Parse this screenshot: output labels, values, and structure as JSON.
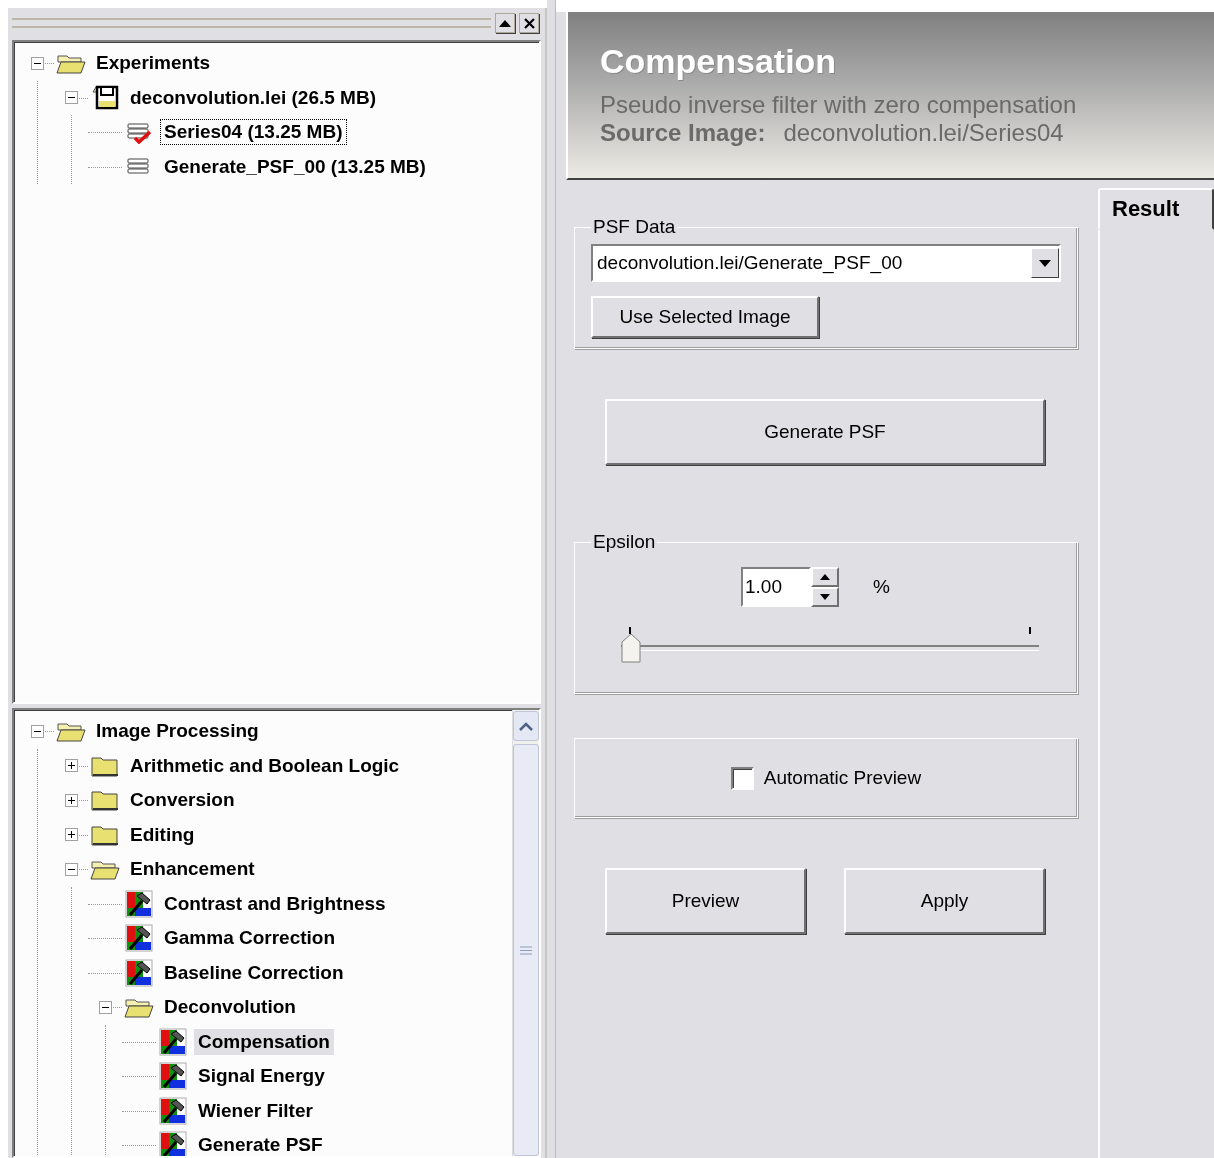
{
  "experiments_tree": {
    "focused": true,
    "items": [
      {
        "label": "Experiments",
        "kind": "folder",
        "expanded": true,
        "selected": false,
        "children": [
          {
            "label": "deconvolution.lei (26.5 MB)",
            "kind": "disk",
            "expanded": true,
            "selected": false,
            "children": [
              {
                "label": "Series04 (13.25 MB)",
                "kind": "series",
                "checked": true,
                "selected": true
              },
              {
                "label": "Generate_PSF_00 (13.25 MB)",
                "kind": "series",
                "checked": false,
                "selected": false
              }
            ]
          }
        ]
      }
    ]
  },
  "processing_tree": {
    "focused": false,
    "items": [
      {
        "label": "Image Processing",
        "kind": "folder",
        "expanded": true,
        "selected": false,
        "children": [
          {
            "label": "Arithmetic and Boolean Logic",
            "kind": "folder",
            "expanded": false,
            "selected": false
          },
          {
            "label": "Conversion",
            "kind": "folder",
            "expanded": false,
            "selected": false
          },
          {
            "label": "Editing",
            "kind": "folder",
            "expanded": false,
            "selected": false
          },
          {
            "label": "Enhancement",
            "kind": "folder",
            "expanded": true,
            "selected": false,
            "children": [
              {
                "label": "Contrast and Brightness",
                "kind": "tool",
                "selected": false
              },
              {
                "label": "Gamma Correction",
                "kind": "tool",
                "selected": false
              },
              {
                "label": "Baseline Correction",
                "kind": "tool",
                "selected": false
              },
              {
                "label": "Deconvolution",
                "kind": "folder",
                "expanded": true,
                "selected": false,
                "children": [
                  {
                    "label": "Compensation",
                    "kind": "tool",
                    "selected": true
                  },
                  {
                    "label": "Signal Energy",
                    "kind": "tool",
                    "selected": false
                  },
                  {
                    "label": "Wiener Filter",
                    "kind": "tool",
                    "selected": false
                  },
                  {
                    "label": "Generate PSF",
                    "kind": "tool",
                    "selected": false
                  }
                ]
              }
            ]
          }
        ]
      }
    ]
  },
  "header": {
    "title": "Compensation",
    "description": "Pseudo inverse filter with zero compensation",
    "source_label": "Source Image:",
    "source_value": "deconvolution.lei/Series04"
  },
  "tabs": [
    {
      "label": "Result",
      "selected": true
    }
  ],
  "psf_data": {
    "legend": "PSF Data",
    "dropdown_value": "deconvolution.lei/Generate_PSF_00",
    "button": "Use Selected Image"
  },
  "generate_button": "Generate PSF",
  "epsilon": {
    "legend": "Epsilon",
    "value": "1.00",
    "unit": "%",
    "level": 0
  },
  "automatic_preview": {
    "label": "Automatic Preview",
    "checked": false
  },
  "buttons": [
    "Preview",
    "Apply"
  ]
}
